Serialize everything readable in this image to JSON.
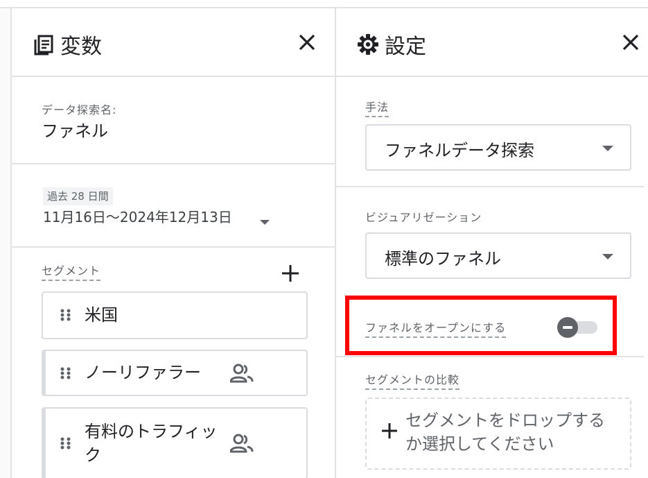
{
  "variables_panel": {
    "title": "変数",
    "exploration_name_label": "データ探索名:",
    "exploration_name_value": "ファネル",
    "date_range": {
      "badge": "過去 28 日間",
      "value": "11月16日～2024年12月13日"
    },
    "segments": {
      "label": "セグメント",
      "items": [
        {
          "name": "米国",
          "has_people_icon": false
        },
        {
          "name": "ノーリファラー",
          "has_people_icon": true
        },
        {
          "name_line1": "有料のトラフィッ",
          "name_line2": "ク",
          "has_people_icon": true
        }
      ]
    }
  },
  "settings_panel": {
    "title": "設定",
    "technique": {
      "label": "手法",
      "selected": "ファネルデータ探索"
    },
    "visualization": {
      "label": "ビジュアリゼーション",
      "selected": "標準のファネル"
    },
    "open_funnel": {
      "label": "ファネルをオープンにする",
      "enabled": false
    },
    "segment_comparison": {
      "label": "セグメントの比較",
      "drop_text_line1": "セグメントをドロップする",
      "drop_text_line2": "か選択してください"
    }
  },
  "colors": {
    "highlight_border": "#ff0000",
    "border": "#dadce0",
    "text_primary": "#202124",
    "text_secondary": "#5f6368"
  }
}
